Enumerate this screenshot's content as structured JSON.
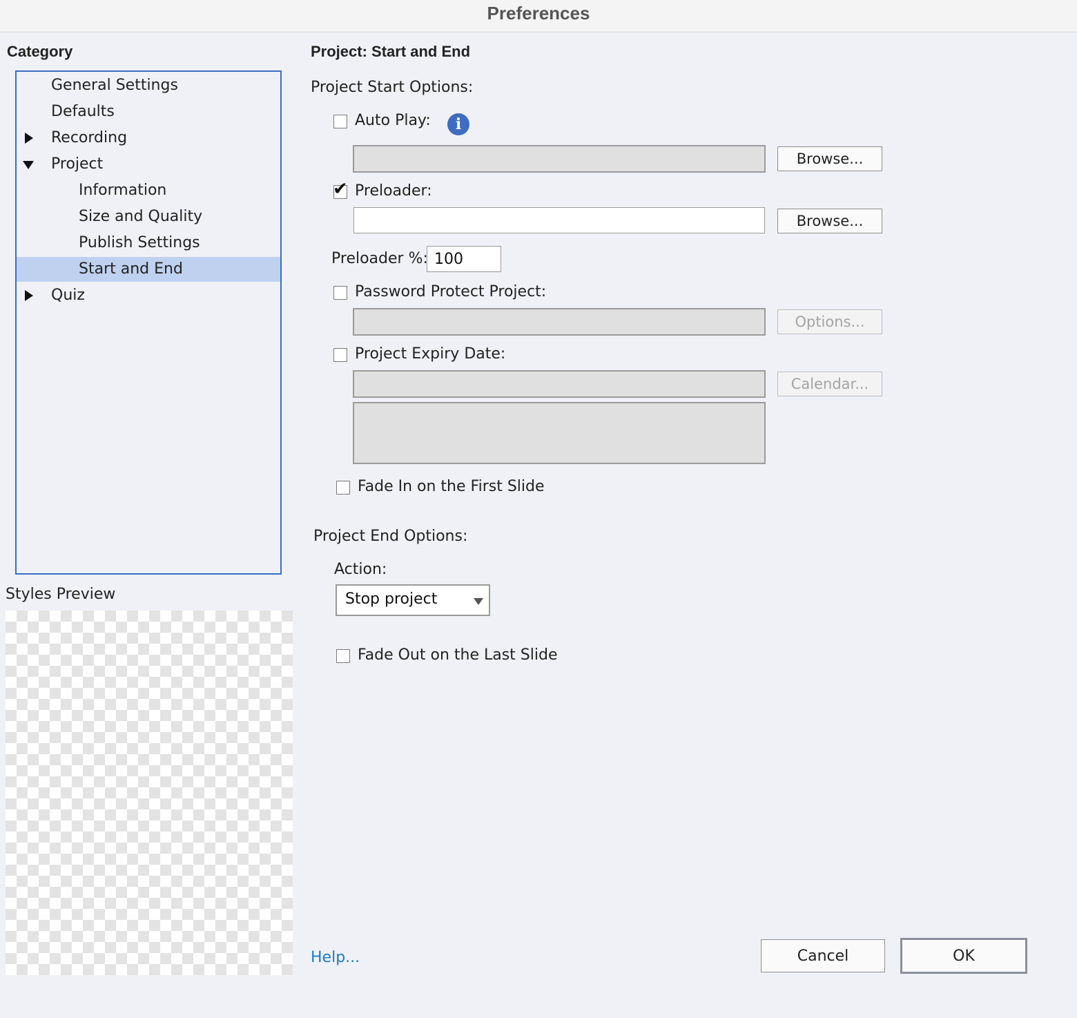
{
  "window": {
    "title": "Preferences"
  },
  "category": {
    "heading": "Category",
    "items": [
      {
        "label": "General Settings"
      },
      {
        "label": "Defaults"
      },
      {
        "label": "Recording"
      },
      {
        "label": "Project"
      },
      {
        "label": "Information"
      },
      {
        "label": "Size and Quality"
      },
      {
        "label": "Publish Settings"
      },
      {
        "label": "Start and End"
      },
      {
        "label": "Quiz"
      }
    ],
    "selected": "Start and End"
  },
  "preview": {
    "heading": "Styles Preview"
  },
  "panel": {
    "title": "Project: Start and End",
    "start_heading": "Project Start Options:",
    "auto_play": {
      "label": "Auto Play:",
      "checked": false,
      "path": "",
      "browse": "Browse..."
    },
    "preloader": {
      "label": "Preloader:",
      "checked": true,
      "path": "",
      "browse": "Browse..."
    },
    "preloader_percent": {
      "label": "Preloader %:",
      "value": "100"
    },
    "password": {
      "label": "Password Protect Project:",
      "checked": false,
      "value": "",
      "button": "Options..."
    },
    "expiry": {
      "label": "Project Expiry Date:",
      "checked": false,
      "value": "",
      "button": "Calendar...",
      "message": ""
    },
    "fade_in": {
      "label": "Fade In on the First Slide",
      "checked": false
    },
    "end_heading": "Project End Options:",
    "action": {
      "label": "Action:",
      "value": "Stop project"
    },
    "fade_out": {
      "label": "Fade Out on the Last Slide",
      "checked": false
    }
  },
  "footer": {
    "help": "Help...",
    "cancel": "Cancel",
    "ok": "OK"
  },
  "colors": {
    "accent": "#3a6dc4",
    "selection": "#bfd1ef",
    "link": "#1d7bc4",
    "background": "#f0f1f6"
  },
  "icons": {
    "info": "info-icon",
    "check": "checkmark-icon",
    "expanded": "triangle-down-icon",
    "collapsed": "triangle-right-icon"
  }
}
